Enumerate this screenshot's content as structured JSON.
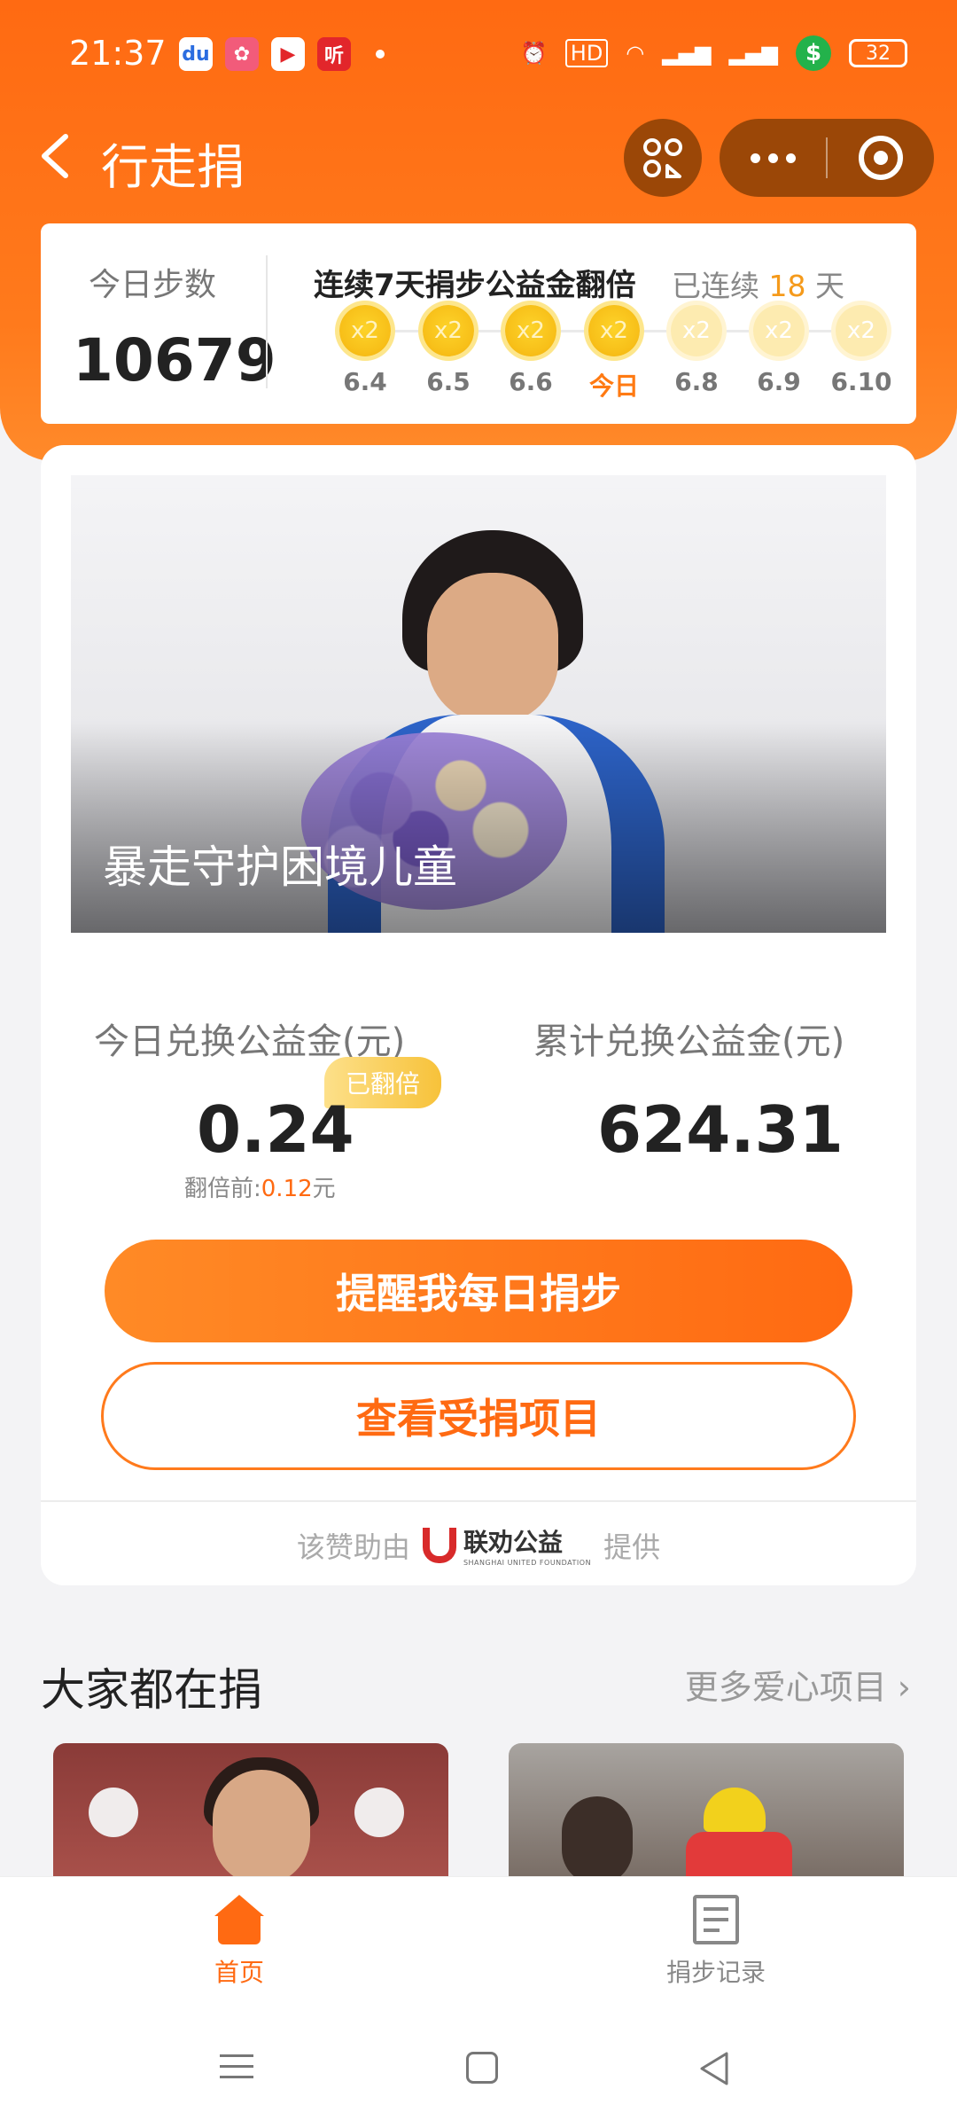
{
  "status": {
    "time": "21:37",
    "app_icons": [
      "baidu-icon",
      "app-icon-2",
      "video-icon",
      "ting-icon"
    ],
    "ting_label": "听",
    "hd_label": "HD",
    "battery": "32"
  },
  "nav": {
    "title": "行走捐"
  },
  "steps": {
    "label": "今日步数",
    "value": "10679",
    "streak_title": "连续7天捐步公益金翻倍",
    "streak_prefix": "已连续",
    "streak_days": "18",
    "streak_suffix": "天",
    "days": [
      {
        "date": "6.4",
        "multiplier": "x2"
      },
      {
        "date": "6.5",
        "multiplier": "x2"
      },
      {
        "date": "6.6",
        "multiplier": "x2"
      },
      {
        "date": "今日",
        "multiplier": "x2"
      },
      {
        "date": "6.8",
        "multiplier": "x2"
      },
      {
        "date": "6.9",
        "multiplier": "x2"
      },
      {
        "date": "6.10",
        "multiplier": "x2"
      }
    ]
  },
  "project": {
    "title": "暴走守护困境儿童",
    "today_label": "今日兑换公益金(元)",
    "today_value": "0.24",
    "doubled_badge": "已翻倍",
    "before_label": "翻倍前:",
    "before_amount": "0.12",
    "before_unit": "元",
    "total_label": "累计兑换公益金(元)",
    "total_value": "624.31",
    "remind_button": "提醒我每日捐步",
    "view_button": "查看受捐项目",
    "sponsor_prefix": "该赞助由",
    "sponsor_name": "联劝公益",
    "sponsor_en": "SHANGHAI UNITED FOUNDATION",
    "sponsor_suffix": "提供"
  },
  "section": {
    "title": "大家都在捐",
    "more": "更多爱心项目"
  },
  "tabbar": {
    "home": "首页",
    "records": "捐步记录"
  },
  "colors": {
    "brand_orange": "#ff6a12",
    "coin_gold": "#f8c11a",
    "streak_orange": "#f59a1b"
  }
}
